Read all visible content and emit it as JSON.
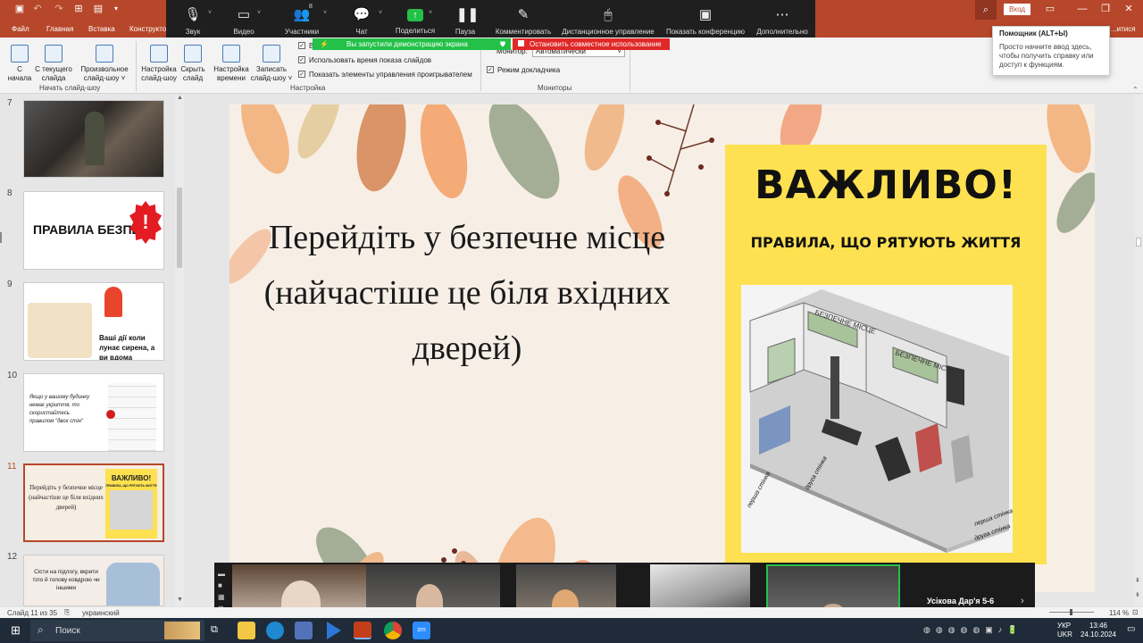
{
  "title_bar": {
    "signin_label": "Вход",
    "right_clip": "...итися"
  },
  "tabs": [
    "Файл",
    "Главная",
    "Вставка",
    "Конструкто"
  ],
  "zoom_toolbar": {
    "items": [
      {
        "label": "Звук",
        "icon": "microphone-icon"
      },
      {
        "label": "Видео",
        "icon": "video-camera-icon"
      },
      {
        "label": "Участники",
        "icon": "participants-icon",
        "badge": "8"
      },
      {
        "label": "Чат",
        "icon": "chat-icon"
      },
      {
        "label": "Поделиться",
        "icon": "share-screen-icon"
      },
      {
        "label": "Пауза",
        "icon": "pause-icon"
      },
      {
        "label": "Комментировать",
        "icon": "annotate-pen-icon"
      },
      {
        "label": "Дистанционное управление",
        "icon": "remote-control-mouse-icon"
      },
      {
        "label": "Показать конференцию",
        "icon": "show-meeting-icon"
      },
      {
        "label": "Дополнительно",
        "icon": "more-dots-icon"
      }
    ],
    "sharing_banner": "Вы запустили демонстрацию экрана",
    "stop_share": "Остановить совместное использование"
  },
  "ribbon": {
    "buttons": [
      {
        "label1": "С",
        "label2": "начала"
      },
      {
        "label1": "С текущего",
        "label2": "слайда"
      },
      {
        "label1": "Произвольное",
        "label2": "слайд-шоу ˅"
      },
      {
        "label1": "Настройка",
        "label2": "слайд-шоу"
      },
      {
        "label1": "Скрыть",
        "label2": "слайд"
      },
      {
        "label1": "Настройка",
        "label2": "времени"
      },
      {
        "label1": "Записать",
        "label2": "слайд-шоу ˅"
      }
    ],
    "groups": [
      "Начать слайд-шоу",
      "Настройка",
      "Мониторы"
    ],
    "checkboxes": [
      {
        "label": "В...",
        "checked": true
      },
      {
        "label": "Использовать время показа слайдов",
        "checked": true
      },
      {
        "label": "Показать элементы управления проигрывателем",
        "checked": true
      }
    ],
    "monitor_label": "Монитор:",
    "monitor_value": "Автоматически",
    "presenter_view": "Режим докладчика"
  },
  "tooltip": {
    "title": "Помощник (ALT+Ы)",
    "body": "Просто начните ввод здесь, чтобы получить справку или доступ к функциям."
  },
  "thumbnails": [
    {
      "num": "7",
      "text": ""
    },
    {
      "num": "8",
      "text": "ПРАВИЛА БЕЗПЕКИ"
    },
    {
      "num": "9",
      "text": "Ваші дії коли лунає сирена, а ви вдома"
    },
    {
      "num": "10",
      "text": "Якщо у вашому будинку немає укриття, то скористайтесь правилом \"двох стін\""
    },
    {
      "num": "11",
      "text": "Перейдіть у безпечне місце (найчастіше це біля вхідних дверей)",
      "badge": "ВАЖЛИВО!",
      "badge_sub": "ПРАВИЛА, ЩО РЯТУЮТЬ ЖИТТЯ",
      "selected": true
    },
    {
      "num": "12",
      "text": "Сісти на підлогу, вкрити тіло й голову ковдрою чи іншими"
    }
  ],
  "slide": {
    "title_lines": [
      "Перейдіть у безпечне місце",
      "(найчастіше це біля вхідних",
      "дверей)"
    ],
    "headline": "ВАЖЛИВО!",
    "subheadline": "ПРАВИЛА, ЩО РЯТУЮТЬ ЖИТТЯ",
    "plan_labels": {
      "safe1": "БЕЗПЕЧНЕ МІСЦЕ",
      "safe2": "БЕЗПЕЧНЕ МІСЦЕ",
      "wall1": "перша стінка",
      "wall2": "друга стінка",
      "wall1b": "перша стінка",
      "wall2b": "друга стінка"
    }
  },
  "video_strip": {
    "speaker_name": "Усікова Дар'я 5-6"
  },
  "status_bar": {
    "slide_info": "Слайд 11 из 35",
    "language": "украинский",
    "zoom": "114 %"
  },
  "taskbar": {
    "search": "Поиск",
    "lang1": "УКР",
    "lang2": "UKR",
    "time": "13:46",
    "date": "24.10.2024"
  },
  "colors": {
    "accent": "#b7472a",
    "share_green": "#23c147",
    "stop_red": "#e02828",
    "slide_yellow": "#fde150"
  }
}
